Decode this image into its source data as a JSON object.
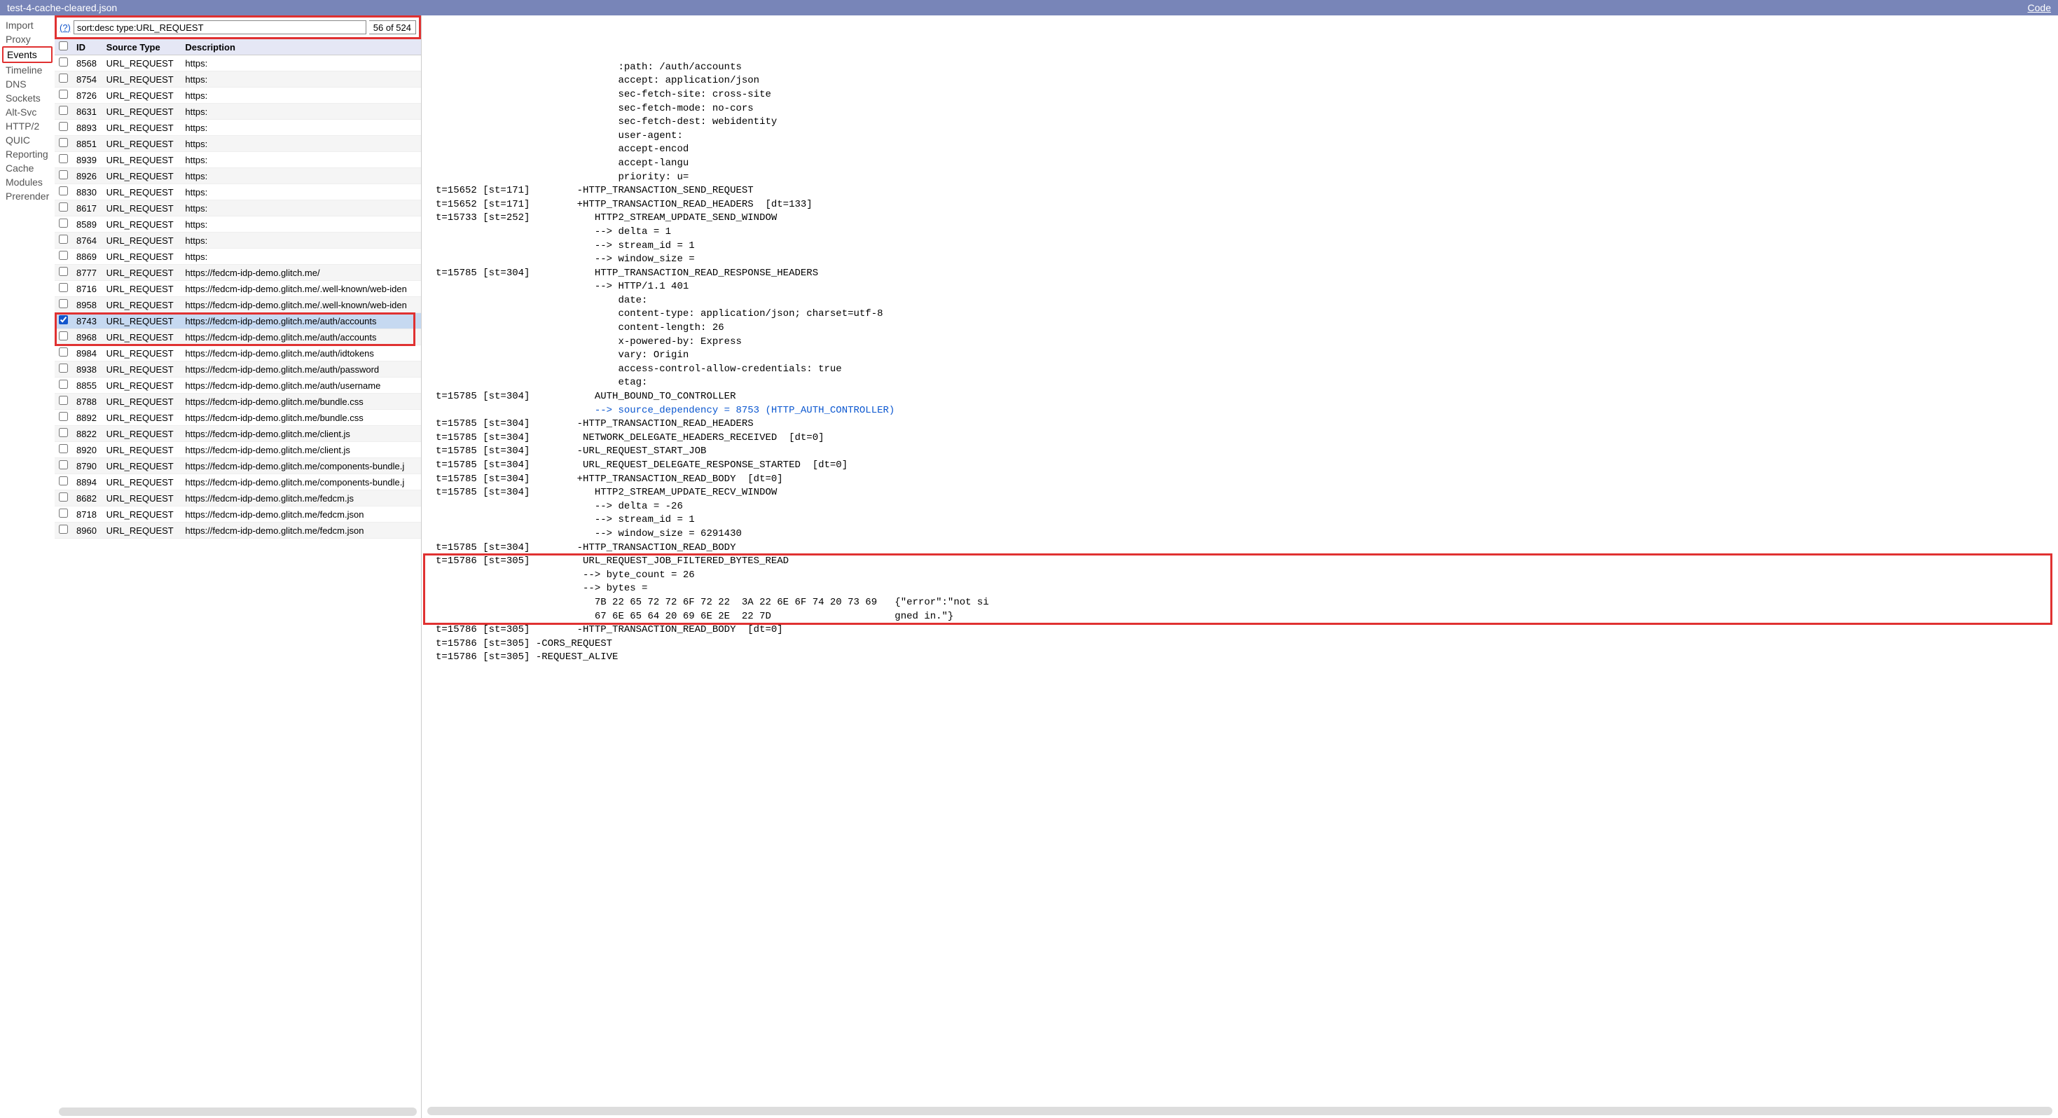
{
  "header": {
    "filename": "test-4-cache-cleared.json",
    "code_link": "Code"
  },
  "sidebar": {
    "items": [
      "Import",
      "Proxy",
      "Events",
      "Timeline",
      "DNS",
      "Sockets",
      "Alt-Svc",
      "HTTP/2",
      "QUIC",
      "Reporting",
      "Cache",
      "Modules",
      "Prerender"
    ],
    "active": "Events"
  },
  "filter": {
    "help": "(?)",
    "value": "sort:desc type:URL_REQUEST",
    "count": "56 of 524"
  },
  "table": {
    "columns": [
      "",
      "ID",
      "Source Type",
      "Description"
    ],
    "rows": [
      {
        "checked": false,
        "id": "8568",
        "type": "URL_REQUEST",
        "desc": "https:"
      },
      {
        "checked": false,
        "id": "8754",
        "type": "URL_REQUEST",
        "desc": "https:"
      },
      {
        "checked": false,
        "id": "8726",
        "type": "URL_REQUEST",
        "desc": "https:"
      },
      {
        "checked": false,
        "id": "8631",
        "type": "URL_REQUEST",
        "desc": "https:"
      },
      {
        "checked": false,
        "id": "8893",
        "type": "URL_REQUEST",
        "desc": "https:"
      },
      {
        "checked": false,
        "id": "8851",
        "type": "URL_REQUEST",
        "desc": "https:"
      },
      {
        "checked": false,
        "id": "8939",
        "type": "URL_REQUEST",
        "desc": "https:"
      },
      {
        "checked": false,
        "id": "8926",
        "type": "URL_REQUEST",
        "desc": "https:"
      },
      {
        "checked": false,
        "id": "8830",
        "type": "URL_REQUEST",
        "desc": "https:"
      },
      {
        "checked": false,
        "id": "8617",
        "type": "URL_REQUEST",
        "desc": "https:"
      },
      {
        "checked": false,
        "id": "8589",
        "type": "URL_REQUEST",
        "desc": "https:"
      },
      {
        "checked": false,
        "id": "8764",
        "type": "URL_REQUEST",
        "desc": "https:"
      },
      {
        "checked": false,
        "id": "8869",
        "type": "URL_REQUEST",
        "desc": "https:"
      },
      {
        "checked": false,
        "id": "8777",
        "type": "URL_REQUEST",
        "desc": "https://fedcm-idp-demo.glitch.me/"
      },
      {
        "checked": false,
        "id": "8716",
        "type": "URL_REQUEST",
        "desc": "https://fedcm-idp-demo.glitch.me/.well-known/web-iden"
      },
      {
        "checked": false,
        "id": "8958",
        "type": "URL_REQUEST",
        "desc": "https://fedcm-idp-demo.glitch.me/.well-known/web-iden"
      },
      {
        "checked": true,
        "id": "8743",
        "type": "URL_REQUEST",
        "desc": "https://fedcm-idp-demo.glitch.me/auth/accounts",
        "selected": true,
        "hl": true
      },
      {
        "checked": false,
        "id": "8968",
        "type": "URL_REQUEST",
        "desc": "https://fedcm-idp-demo.glitch.me/auth/accounts",
        "hl": true
      },
      {
        "checked": false,
        "id": "8984",
        "type": "URL_REQUEST",
        "desc": "https://fedcm-idp-demo.glitch.me/auth/idtokens"
      },
      {
        "checked": false,
        "id": "8938",
        "type": "URL_REQUEST",
        "desc": "https://fedcm-idp-demo.glitch.me/auth/password"
      },
      {
        "checked": false,
        "id": "8855",
        "type": "URL_REQUEST",
        "desc": "https://fedcm-idp-demo.glitch.me/auth/username"
      },
      {
        "checked": false,
        "id": "8788",
        "type": "URL_REQUEST",
        "desc": "https://fedcm-idp-demo.glitch.me/bundle.css"
      },
      {
        "checked": false,
        "id": "8892",
        "type": "URL_REQUEST",
        "desc": "https://fedcm-idp-demo.glitch.me/bundle.css"
      },
      {
        "checked": false,
        "id": "8822",
        "type": "URL_REQUEST",
        "desc": "https://fedcm-idp-demo.glitch.me/client.js"
      },
      {
        "checked": false,
        "id": "8920",
        "type": "URL_REQUEST",
        "desc": "https://fedcm-idp-demo.glitch.me/client.js"
      },
      {
        "checked": false,
        "id": "8790",
        "type": "URL_REQUEST",
        "desc": "https://fedcm-idp-demo.glitch.me/components-bundle.j"
      },
      {
        "checked": false,
        "id": "8894",
        "type": "URL_REQUEST",
        "desc": "https://fedcm-idp-demo.glitch.me/components-bundle.j"
      },
      {
        "checked": false,
        "id": "8682",
        "type": "URL_REQUEST",
        "desc": "https://fedcm-idp-demo.glitch.me/fedcm.js"
      },
      {
        "checked": false,
        "id": "8718",
        "type": "URL_REQUEST",
        "desc": "https://fedcm-idp-demo.glitch.me/fedcm.json"
      },
      {
        "checked": false,
        "id": "8960",
        "type": "URL_REQUEST",
        "desc": "https://fedcm-idp-demo.glitch.me/fedcm.json"
      }
    ]
  },
  "log": {
    "header_lines": [
      "                               :path: /auth/accounts",
      "                               accept: application/json",
      "                               sec-fetch-site: cross-site",
      "                               sec-fetch-mode: no-cors",
      "                               sec-fetch-dest: webidentity",
      "                               user-agent:",
      "                               accept-encod",
      "                               accept-langu",
      "                               priority: u="
    ],
    "block1": [
      "t=15652 [st=171]        -HTTP_TRANSACTION_SEND_REQUEST",
      "t=15652 [st=171]        +HTTP_TRANSACTION_READ_HEADERS  [dt=133]",
      "t=15733 [st=252]           HTTP2_STREAM_UPDATE_SEND_WINDOW",
      "                           --> delta = 1",
      "                           --> stream_id = 1",
      "                           --> window_size =",
      "t=15785 [st=304]           HTTP_TRANSACTION_READ_RESPONSE_HEADERS",
      "                           --> HTTP/1.1 401",
      "                               date:",
      "                               content-type: application/json; charset=utf-8",
      "                               content-length: 26",
      "                               x-powered-by: Express",
      "                               vary: Origin",
      "                               access-control-allow-credentials: true",
      "                               etag:",
      "t=15785 [st=304]           AUTH_BOUND_TO_CONTROLLER"
    ],
    "blue_line": "                           --> source_dependency = 8753 (HTTP_AUTH_CONTROLLER)",
    "block2": [
      "t=15785 [st=304]        -HTTP_TRANSACTION_READ_HEADERS",
      "t=15785 [st=304]         NETWORK_DELEGATE_HEADERS_RECEIVED  [dt=0]",
      "t=15785 [st=304]        -URL_REQUEST_START_JOB",
      "t=15785 [st=304]         URL_REQUEST_DELEGATE_RESPONSE_STARTED  [dt=0]",
      "t=15785 [st=304]        +HTTP_TRANSACTION_READ_BODY  [dt=0]",
      "t=15785 [st=304]           HTTP2_STREAM_UPDATE_RECV_WINDOW",
      "                           --> delta = -26",
      "                           --> stream_id = 1",
      "                           --> window_size = 6291430",
      "t=15785 [st=304]        -HTTP_TRANSACTION_READ_BODY"
    ],
    "hl_block": [
      "t=15786 [st=305]         URL_REQUEST_JOB_FILTERED_BYTES_READ",
      "                         --> byte_count = 26",
      "                         --> bytes =",
      "                           7B 22 65 72 72 6F 72 22  3A 22 6E 6F 74 20 73 69   {\"error\":\"not si",
      "                           67 6E 65 64 20 69 6E 2E  22 7D                     gned in.\"}"
    ],
    "block3": [
      "t=15786 [st=305]        -HTTP_TRANSACTION_READ_BODY  [dt=0]",
      "t=15786 [st=305] -CORS_REQUEST",
      "t=15786 [st=305] -REQUEST_ALIVE"
    ]
  }
}
